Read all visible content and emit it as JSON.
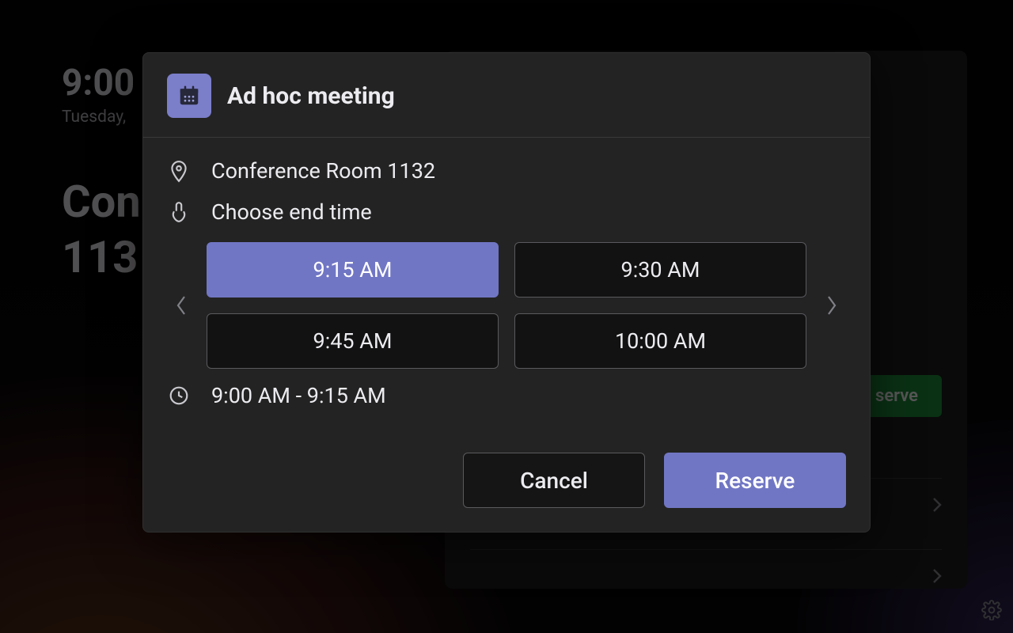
{
  "background": {
    "time": "9:00",
    "date": "Tuesday,",
    "room_name_line1": "Con",
    "room_name_line2": "113",
    "reserve_label": "serve"
  },
  "modal": {
    "title": "Ad hoc meeting",
    "room": "Conference Room 1132",
    "choose_label": "Choose end time",
    "options": [
      "9:15 AM",
      "9:30 AM",
      "9:45 AM",
      "10:00 AM"
    ],
    "selected_index": 0,
    "range_text": "9:00 AM - 9:15 AM",
    "cancel_label": "Cancel",
    "reserve_label": "Reserve"
  }
}
